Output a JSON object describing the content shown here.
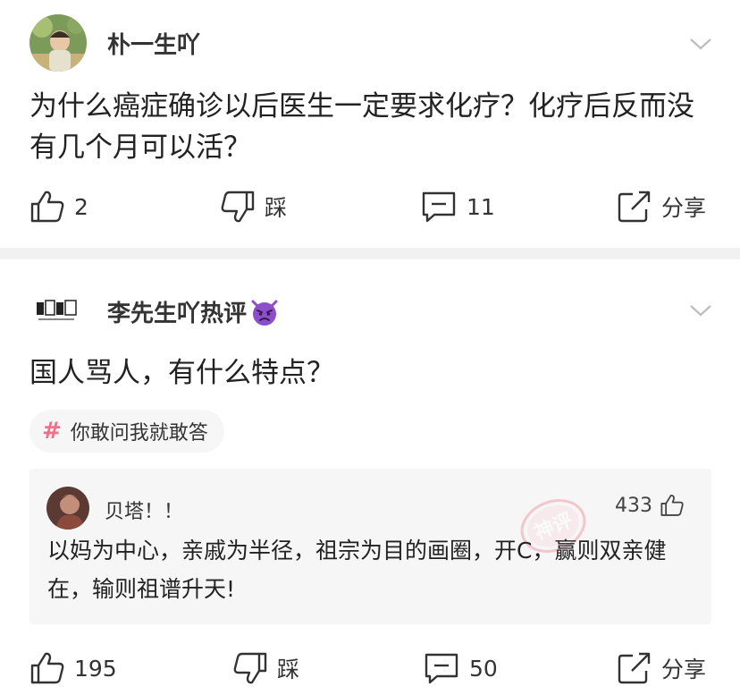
{
  "posts": [
    {
      "username": "朴一生吖",
      "content": "为什么癌症确诊以后医生一定要求化疗？化疗后反而没有几个月可以活？",
      "actions": {
        "like": "2",
        "dislike": "踩",
        "comment": "11",
        "share": "分享"
      }
    },
    {
      "username": "李先生吖热评",
      "badge_icon": "purple-devil-emoji",
      "content": "国人骂人，有什么特点？",
      "topic": "你敢问我就敢答",
      "hot_comment": {
        "author": "贝塔！！",
        "likes": "433",
        "text": "以妈为中心，亲戚为半径，祖宗为目的画圈，开C，赢则双亲健在，输则祖谱升天!",
        "stamp": "神评"
      },
      "actions": {
        "like": "195",
        "dislike": "踩",
        "comment": "50",
        "share": "分享"
      }
    }
  ],
  "colors": {
    "topic_hash": "#f0708a",
    "divider": "#f1f1f1",
    "comment_bg": "#f6f6f6",
    "stamp": "#f08a9c"
  }
}
